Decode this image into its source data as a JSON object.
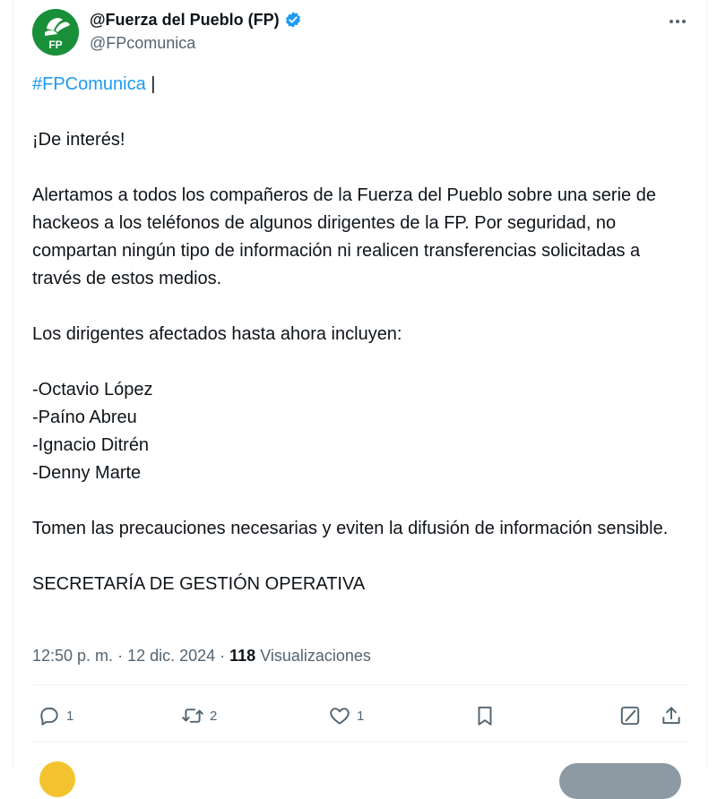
{
  "author": {
    "name": "@Fuerza del Pueblo (FP)",
    "handle": "@FPcomunica",
    "avatar_text": "FP",
    "verified": true
  },
  "tweet": {
    "hashtag": "#FPComunica",
    "hashtag_suffix": " |",
    "line_interest": "¡De interés!",
    "para_alert": "Alertamos a todos los compañeros de la Fuerza del Pueblo sobre una serie de hackeos a los teléfonos de algunos dirigentes de la FP. Por seguridad, no compartan ningún tipo de información ni realicen transferencias solicitadas a través de estos medios.",
    "line_affected": "Los dirigentes afectados hasta ahora incluyen:",
    "names": [
      "-Octavio López",
      "-Paíno Abreu",
      "-Ignacio Ditrén",
      "-Denny Marte"
    ],
    "para_precautions": "Tomen las precauciones necesarias y eviten la difusión de información sensible.",
    "signature": "SECRETARÍA DE GESTIÓN OPERATIVA"
  },
  "meta": {
    "time": "12:50 p. m.",
    "sep1": " · ",
    "date": "12 dic. 2024",
    "sep2": " · ",
    "views_count": "118",
    "views_label": " Visualizaciones"
  },
  "actions": {
    "replies": "1",
    "reposts": "2",
    "likes": "1"
  },
  "colors": {
    "accent": "#1d9bf0",
    "brand_green": "#1a8f3a",
    "muted": "#536471"
  }
}
